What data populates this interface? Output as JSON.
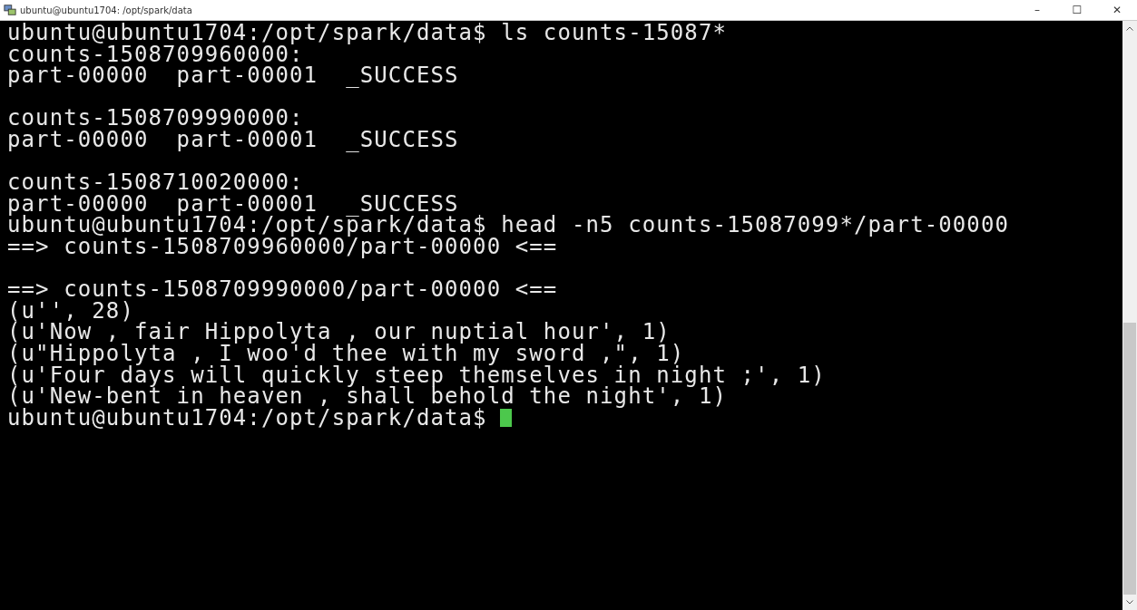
{
  "window": {
    "title": "ubuntu@ubuntu1704: /opt/spark/data",
    "controls": [
      "–",
      "☐",
      "✕"
    ]
  },
  "terminal": {
    "lines": [
      {
        "kind": "text",
        "text": "ubuntu@ubuntu1704:/opt/spark/data$ ls counts-15087*"
      },
      {
        "kind": "text",
        "text": "counts-1508709960000:"
      },
      {
        "kind": "text",
        "text": "part-00000  part-00001  _SUCCESS"
      },
      {
        "kind": "blank"
      },
      {
        "kind": "text",
        "text": "counts-1508709990000:"
      },
      {
        "kind": "text",
        "text": "part-00000  part-00001  _SUCCESS"
      },
      {
        "kind": "blank"
      },
      {
        "kind": "text",
        "text": "counts-1508710020000:"
      },
      {
        "kind": "text",
        "text": "part-00000  part-00001  _SUCCESS"
      },
      {
        "kind": "text",
        "text": "ubuntu@ubuntu1704:/opt/spark/data$ head -n5 counts-15087099*/part-00000"
      },
      {
        "kind": "text",
        "text": "==> counts-1508709960000/part-00000 <=="
      },
      {
        "kind": "blank"
      },
      {
        "kind": "text",
        "text": "==> counts-1508709990000/part-00000 <=="
      },
      {
        "kind": "text",
        "text": "(u'', 28)"
      },
      {
        "kind": "text",
        "text": "(u'Now , fair Hippolyta , our nuptial hour', 1)"
      },
      {
        "kind": "text",
        "text": "(u\"Hippolyta , I woo'd thee with my sword ,\", 1)"
      },
      {
        "kind": "text",
        "text": "(u'Four days will quickly steep themselves in night ;', 1)"
      },
      {
        "kind": "text",
        "text": "(u'New-bent in heaven , shall behold the night', 1)"
      },
      {
        "kind": "text",
        "text": "ubuntu@ubuntu1704:/opt/spark/data$"
      }
    ],
    "cursor": true
  }
}
